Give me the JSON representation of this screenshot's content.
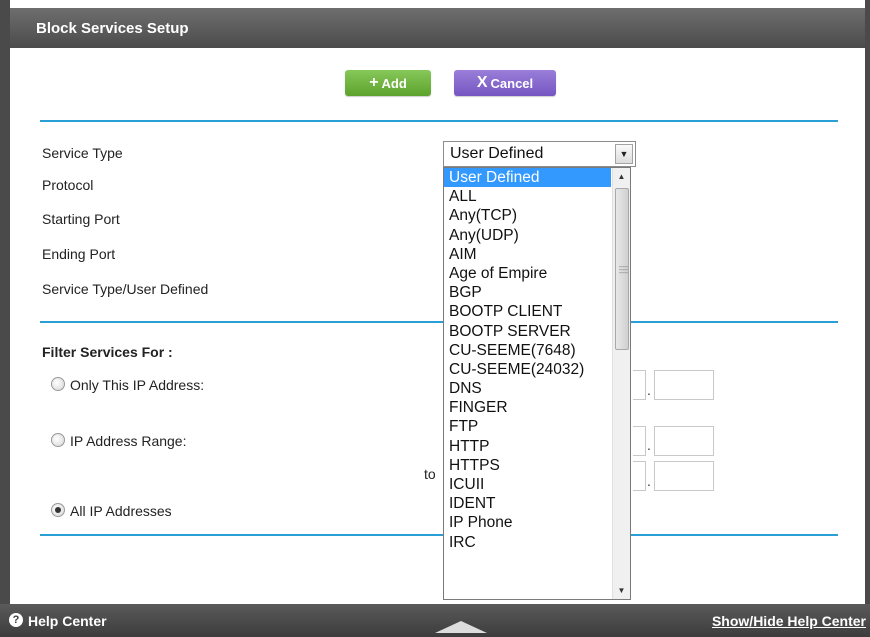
{
  "page": {
    "title": "Block Services Setup"
  },
  "buttons": {
    "add": "Add",
    "add_icon": "+",
    "cancel": "Cancel",
    "cancel_icon": "X"
  },
  "form": {
    "service_type_label": "Service Type",
    "protocol_label": "Protocol",
    "starting_port_label": "Starting Port",
    "ending_port_label": "Ending Port",
    "service_type_user_defined_label": "Service Type/User Defined",
    "service_type_value": "User Defined"
  },
  "filter": {
    "heading": "Filter Services For :",
    "only_this_ip": "Only This IP Address:",
    "ip_range": "IP Address Range:",
    "to": "to",
    "all_ip": "All IP Addresses",
    "selected": "All IP Addresses"
  },
  "dropdown": {
    "options": [
      "User Defined",
      "ALL",
      "Any(TCP)",
      "Any(UDP)",
      "AIM",
      "Age of Empire",
      "BGP",
      "BOOTP CLIENT",
      "BOOTP SERVER",
      "CU-SEEME(7648)",
      "CU-SEEME(24032)",
      "DNS",
      "FINGER",
      "FTP",
      "HTTP",
      "HTTPS",
      "ICUII",
      "IDENT",
      "IP Phone",
      "IRC"
    ],
    "highlighted": "User Defined"
  },
  "footer": {
    "help": "Help Center",
    "toggle": "Show/Hide Help Center"
  },
  "colors": {
    "accent": "#2a9fd6",
    "add": "#6cb33f",
    "cancel": "#7d5fc9",
    "highlight": "#3399ff"
  }
}
